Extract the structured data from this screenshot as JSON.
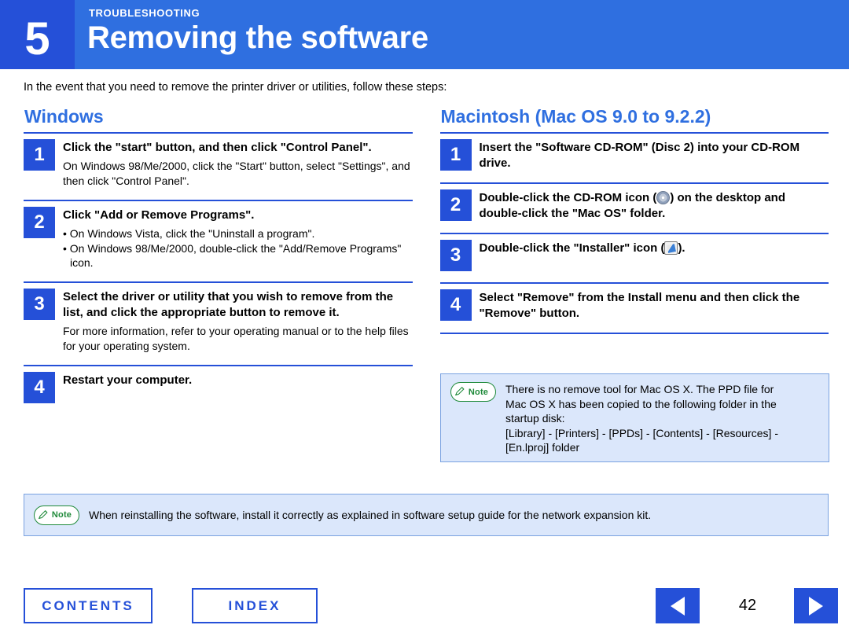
{
  "header": {
    "section_label": "TROUBLESHOOTING",
    "chapter_number": "5",
    "title": "Removing the software"
  },
  "intro": "In the event that you need to remove the printer driver or utilities, follow these steps:",
  "windows": {
    "title": "Windows",
    "steps": [
      {
        "num": "1",
        "head": "Click the \"start\" button, and then click \"Control Panel\".",
        "desc": "On Windows 98/Me/2000, click the \"Start\" button, select \"Settings\", and then click \"Control Panel\"."
      },
      {
        "num": "2",
        "head": "Click \"Add or Remove Programs\".",
        "desc_line1": "• On Windows Vista, click the \"Uninstall a program\".",
        "desc_line2": "• On Windows 98/Me/2000, double-click the \"Add/Remove Programs\" icon."
      },
      {
        "num": "3",
        "head": "Select the driver or utility that you wish to remove from the list, and click the appropriate button to remove it.",
        "desc": "For more information, refer to your operating manual or to the help files for your operating system."
      },
      {
        "num": "4",
        "head": "Restart your computer."
      }
    ]
  },
  "macintosh": {
    "title": "Macintosh (Mac OS 9.0 to 9.2.2)",
    "steps": [
      {
        "num": "1",
        "head": "Insert the \"Software CD-ROM\" (Disc 2) into your CD-ROM drive."
      },
      {
        "num": "2",
        "head_before": "Double-click the CD-ROM icon (",
        "head_after": ") on the desktop and double-click the \"Mac OS\" folder.",
        "icon": "cd-rom-icon"
      },
      {
        "num": "3",
        "head_before": "Double-click the \"Installer\" icon (",
        "head_after": ").",
        "icon": "installer-icon"
      },
      {
        "num": "4",
        "head": "Select \"Remove\" from the Install menu and then click the \"Remove\" button."
      }
    ],
    "note": {
      "label": "Note",
      "line1": "There is no remove tool for Mac OS X. The PPD file for",
      "line2": "Mac OS X has been copied to the following folder in the",
      "line3": "startup disk:",
      "line4": "[Library] - [Printers] - [PPDs] - [Contents] - [Resources] -",
      "line5": "[En.lproj] folder"
    }
  },
  "bottom_note": {
    "label": "Note",
    "text": "When reinstalling the software, install it correctly as explained in software setup guide for the network expansion kit."
  },
  "footer": {
    "contents": "CONTENTS",
    "index": "INDEX",
    "page_number": "42",
    "prev_icon": "triangle-left-icon",
    "next_icon": "triangle-right-icon"
  },
  "colors": {
    "header_blue": "#2f6fe0",
    "dark_blue": "#2550d8",
    "note_bg": "#dbe7fb",
    "note_border": "#7aa2e0",
    "note_green": "#1f8a3a"
  }
}
